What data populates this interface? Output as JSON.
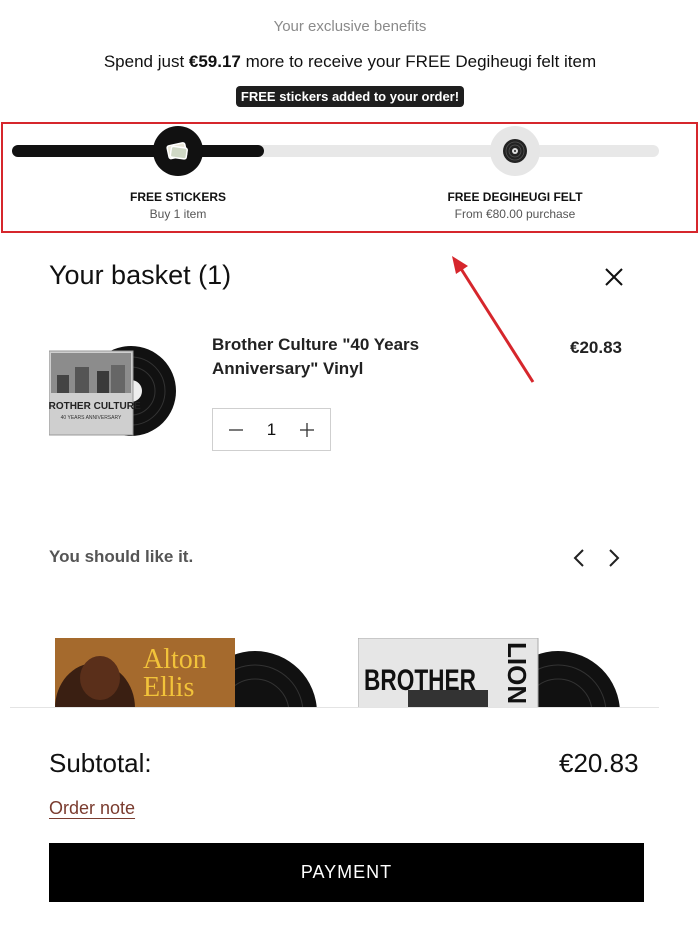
{
  "benefits": {
    "caption": "Your exclusive benefits",
    "spend_prefix": "Spend just ",
    "spend_amount": "€59.17",
    "spend_suffix": " more to receive your FREE Degiheugi felt item",
    "added_badge": "FREE stickers added to your order!"
  },
  "progress": {
    "fraction": 0.39,
    "milestones": [
      {
        "title": "FREE STICKERS",
        "subtitle": "Buy 1 item",
        "reached": true,
        "icon": "sticker-icon"
      },
      {
        "title": "FREE DEGIHEUGI FELT",
        "subtitle": "From €80.00 purchase",
        "reached": false,
        "icon": "vinyl-record-icon"
      }
    ]
  },
  "basket": {
    "title": "Your basket (1)",
    "items": [
      {
        "name": "Brother Culture \"40 Years Anniversary\" Vinyl",
        "price": "€20.83",
        "quantity": "1",
        "cover_text_line1": "BROTHER CULTURE",
        "cover_text_line2": "40 YEARS ANNIVERSARY"
      }
    ]
  },
  "recommendations": {
    "title": "You should like it.",
    "cards": [
      {
        "cover_line1": "Alton",
        "cover_line2": "Ellis"
      },
      {
        "cover_line1": "BROTHER",
        "cover_line2": "LION"
      }
    ]
  },
  "footer": {
    "subtotal_label": "Subtotal:",
    "subtotal_value": "€20.83",
    "order_note": "Order note",
    "payment_button": "PAYMENT"
  },
  "colors": {
    "highlight": "#d6262c",
    "progress_fill": "#111111",
    "progress_track": "#e8e8e8",
    "order_note": "#7a3b2e"
  }
}
